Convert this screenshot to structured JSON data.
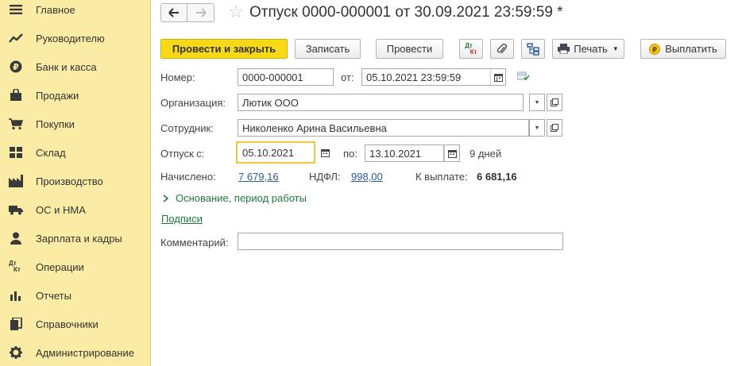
{
  "sidebar": {
    "items": [
      {
        "label": "Главное",
        "icon": "menu-icon"
      },
      {
        "label": "Руководителю",
        "icon": "trend-icon"
      },
      {
        "label": "Банк и касса",
        "icon": "ruble-icon"
      },
      {
        "label": "Продажи",
        "icon": "shopping-bag-icon"
      },
      {
        "label": "Покупки",
        "icon": "cart-icon"
      },
      {
        "label": "Склад",
        "icon": "warehouse-grid-icon"
      },
      {
        "label": "Производство",
        "icon": "factory-icon"
      },
      {
        "label": "ОС и НМА",
        "icon": "truck-icon"
      },
      {
        "label": "Зарплата и кадры",
        "icon": "person-icon"
      },
      {
        "label": "Операции",
        "icon": "dt-kt-icon"
      },
      {
        "label": "Отчеты",
        "icon": "bar-chart-icon"
      },
      {
        "label": "Справочники",
        "icon": "books-icon"
      },
      {
        "label": "Администрирование",
        "icon": "gear-icon"
      }
    ],
    "dtkt_text": {
      "dt": "Дт",
      "kt": "Кт"
    }
  },
  "header": {
    "title": "Отпуск 0000-000001 от 30.09.2021 23:59:59 *"
  },
  "toolbar": {
    "post_close": "Провести и закрыть",
    "save": "Записать",
    "post": "Провести",
    "dtkt": {
      "dt": "Дт",
      "kt": "Кт"
    },
    "print": "Печать",
    "pay": "Выплатить"
  },
  "form": {
    "number_label": "Номер:",
    "number_value": "0000-000001",
    "from_label": "от:",
    "date_value": "05.10.2021 23:59:59",
    "org_label": "Организация:",
    "org_value": "Лютик ООО",
    "employee_label": "Сотрудник:",
    "employee_value": "Николенко Арина Васильевна",
    "vacation_from_label": "Отпуск с:",
    "vacation_from_value": "05.10.2021",
    "vacation_to_label": "по:",
    "vacation_to_value": "13.10.2021",
    "days": "9 дней",
    "accrued_label": "Начислено:",
    "accrued_value": "7 679,16",
    "ndfl_label": "НДФЛ:",
    "ndfl_value": "998,00",
    "to_pay_label": "К выплате:",
    "to_pay_value": "6 681,16",
    "basis_link": "Основание, период работы",
    "signatures_link": "Подписи",
    "comment_label": "Комментарий:",
    "comment_value": ""
  },
  "colors": {
    "sidebar_bg": "#fbeca5",
    "primary_button": "#f7d91a",
    "link_blue": "#2a5d9b",
    "link_green": "#1f7a3a"
  }
}
